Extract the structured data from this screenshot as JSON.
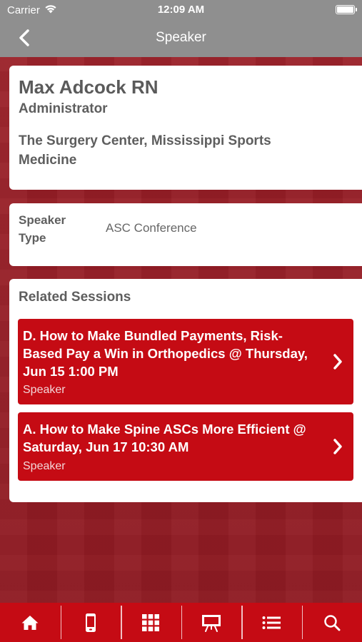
{
  "status_bar": {
    "carrier": "Carrier",
    "time": "12:09 AM"
  },
  "nav": {
    "title": "Speaker"
  },
  "speaker": {
    "name": "Max Adcock RN",
    "role": "Administrator",
    "organization": "The Surgery Center, Mississippi Sports Medicine"
  },
  "details": {
    "type_label": "Speaker Type",
    "type_value": "ASC Conference"
  },
  "related": {
    "title": "Related Sessions",
    "sessions": [
      {
        "title": "D. How to Make Bundled Payments, Risk-Based Pay a Win in Orthopedics @ Thursday, Jun 15 1:00 PM",
        "role": "Speaker"
      },
      {
        "title": "A. How to Make Spine ASCs More Efficient @ Saturday, Jun 17 10:30 AM",
        "role": "Speaker"
      }
    ]
  },
  "tab_bar": {
    "tabs": [
      {
        "icon": "home-icon"
      },
      {
        "icon": "phone-icon"
      },
      {
        "icon": "grid-icon"
      },
      {
        "icon": "presentation-icon"
      },
      {
        "icon": "list-icon"
      },
      {
        "icon": "search-icon"
      }
    ]
  },
  "colors": {
    "accent": "#c50b14",
    "navbar": "#8f8f8f",
    "background": "#9b1f27"
  }
}
